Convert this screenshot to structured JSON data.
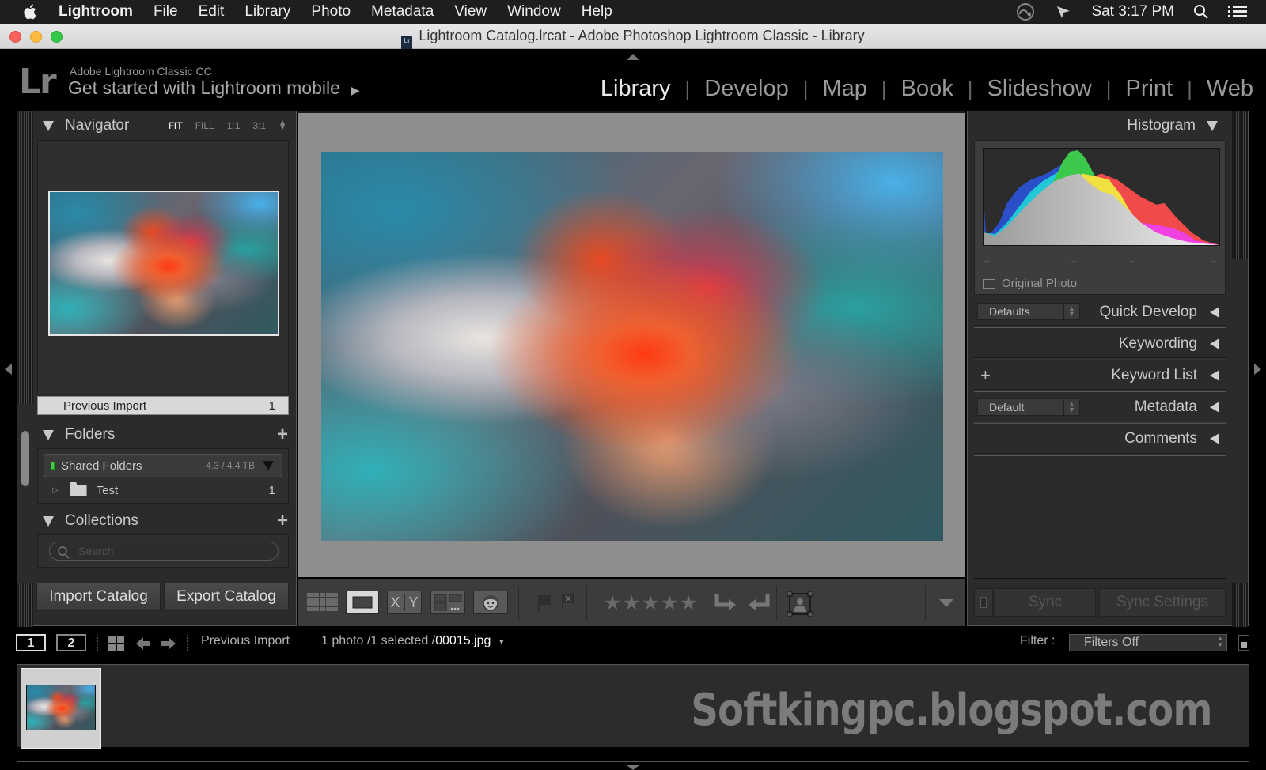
{
  "menubar": {
    "app": "Lightroom",
    "items": [
      "File",
      "Edit",
      "Library",
      "Photo",
      "Metadata",
      "View",
      "Window",
      "Help"
    ],
    "clock": "Sat 3:17 PM"
  },
  "window": {
    "title": "Lightroom Catalog.lrcat - Adobe Photoshop Lightroom Classic - Library",
    "doc_icon_text": "Lr"
  },
  "identity": {
    "logo": "Lr",
    "product": "Adobe Lightroom Classic CC",
    "tagline": "Get started with Lightroom mobile",
    "tagline_arrow": "▶"
  },
  "modules": [
    {
      "label": "Library",
      "active": true
    },
    {
      "label": "Develop",
      "active": false
    },
    {
      "label": "Map",
      "active": false
    },
    {
      "label": "Book",
      "active": false
    },
    {
      "label": "Slideshow",
      "active": false
    },
    {
      "label": "Print",
      "active": false
    },
    {
      "label": "Web",
      "active": false
    }
  ],
  "left_panel": {
    "navigator": {
      "title": "Navigator",
      "zoom_options": [
        "FIT",
        "FILL",
        "1:1",
        "3:1"
      ],
      "selected_zoom": "FIT"
    },
    "catalog_row": {
      "label": "Previous Import",
      "count": "1"
    },
    "folders": {
      "title": "Folders",
      "volume": {
        "name": "Shared Folders",
        "usage": "4.3 / 4.4 TB"
      },
      "items": [
        {
          "name": "Test",
          "count": "1"
        }
      ]
    },
    "collections": {
      "title": "Collections",
      "search_placeholder": "Search"
    },
    "import_button": "Import Catalog",
    "export_button": "Export Catalog"
  },
  "toolbar": {
    "compare_labels": [
      "X",
      "Y"
    ],
    "rating_stars": 5,
    "rating_value": 0
  },
  "right_panel": {
    "histogram": {
      "title": "Histogram",
      "original_photo_label": "Original Photo",
      "readouts": [
        "–",
        "–",
        "–",
        "–"
      ]
    },
    "quick_develop": {
      "title": "Quick Develop",
      "preset": "Defaults"
    },
    "keywording": {
      "title": "Keywording"
    },
    "keyword_list": {
      "title": "Keyword List",
      "add": "+"
    },
    "metadata": {
      "title": "Metadata",
      "preset": "Default"
    },
    "comments": {
      "title": "Comments"
    },
    "sync_button": "Sync",
    "sync_settings_button": "Sync Settings"
  },
  "filmstrip_bar": {
    "screen1": "1",
    "screen2": "2",
    "source": "Previous Import",
    "status_prefix": "1 photo /1 selected /",
    "filename": "00015.jpg",
    "filter_label": "Filter :",
    "filter_value": "Filters Off"
  },
  "watermark": "Softkingpc.blogspot.com",
  "colors": {
    "traffic_red": "#fc605b",
    "traffic_yellow": "#fdbc40",
    "traffic_green": "#34c84a",
    "panel_bg": "#2b2b2b",
    "canvas_bg": "#8e8e8e"
  }
}
